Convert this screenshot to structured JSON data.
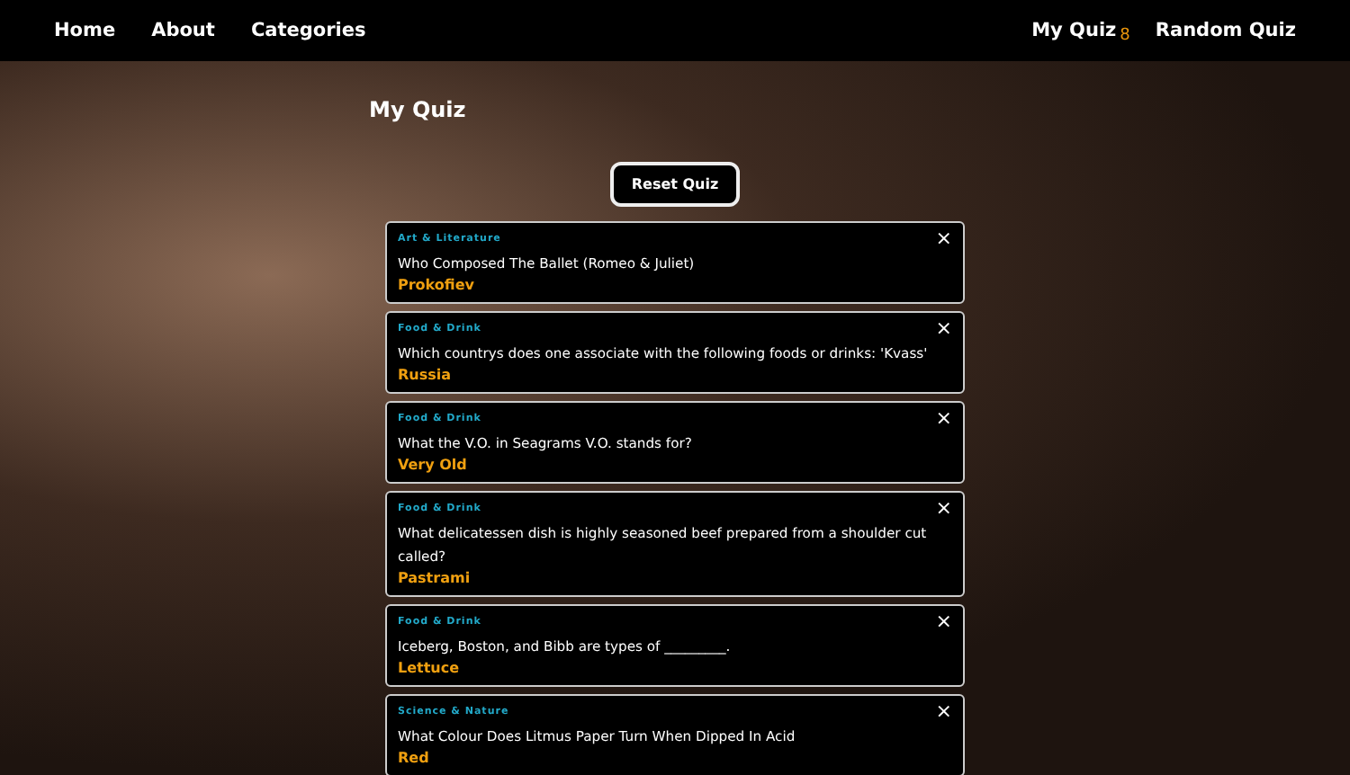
{
  "nav": {
    "left": [
      "Home",
      "About",
      "Categories"
    ],
    "quiz_link": "My Quiz",
    "quiz_count": "8",
    "random_link": "Random Quiz"
  },
  "title": "My Quiz",
  "reset_button": "Reset Quiz",
  "close_glyph": "×",
  "cards": [
    {
      "category": "Art & Literature",
      "question": "Who Composed The Ballet (Romeo & Juliet)",
      "answer": "Prokofiev"
    },
    {
      "category": "Food & Drink",
      "question": "Which countrys does one associate with the following foods or drinks: 'Kvass'",
      "answer": "Russia"
    },
    {
      "category": "Food & Drink",
      "question": "What the V.O. in Seagrams V.O. stands for?",
      "answer": "Very Old"
    },
    {
      "category": "Food & Drink",
      "question": "What delicatessen dish is highly seasoned beef prepared from a shoulder cut called?",
      "answer": "Pastrami"
    },
    {
      "category": "Food & Drink",
      "question": "Iceberg, Boston, and Bibb are types of _________.",
      "answer": "Lettuce"
    },
    {
      "category": "Science & Nature",
      "question": "What Colour Does Litmus Paper Turn When Dipped In Acid",
      "answer": "Red"
    }
  ]
}
